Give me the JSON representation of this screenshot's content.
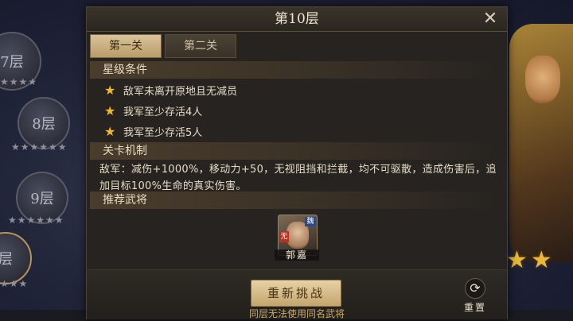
{
  "modal": {
    "title": "第10层",
    "tabs": [
      {
        "label": "第一关",
        "active": true
      },
      {
        "label": "第二关",
        "active": false
      }
    ],
    "star_conditions": {
      "header": "星级条件",
      "items": [
        "敌军未离开原地且无减员",
        "我军至少存活4人",
        "我军至少存活5人"
      ]
    },
    "mechanics": {
      "header": "关卡机制",
      "text": "敌军：减伤+1000%，移动力+50，无视阻挡和拦截，均不可驱散，造成伤害后，追加目标100%生命的真实伤害。"
    },
    "recommended": {
      "header": "推荐武将",
      "general_name": "郭嘉",
      "faction_tag": "魏",
      "role_tag": "无"
    },
    "footer": {
      "retry_label": "重新挑战",
      "note": "同层无法使用同名武将",
      "reset_label": "重置"
    }
  },
  "background": {
    "floors": [
      {
        "label": "7层"
      },
      {
        "label": "8层"
      },
      {
        "label": "9层"
      },
      {
        "label": "层"
      }
    ]
  },
  "colors": {
    "accent_gold": "#f2b630",
    "panel_bg": "#262320",
    "button_gold": "#d9c49a"
  }
}
